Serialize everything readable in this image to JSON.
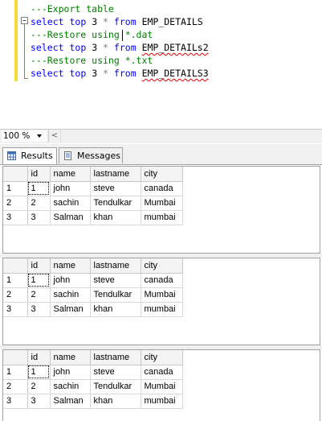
{
  "editor": {
    "lines": [
      {
        "parts": [
          {
            "t": "---Export table",
            "c": "cm"
          }
        ]
      },
      {
        "parts": [
          {
            "t": "select",
            "c": "kw"
          },
          {
            "t": " ",
            "c": ""
          },
          {
            "t": "top",
            "c": "kw"
          },
          {
            "t": " 3 ",
            "c": ""
          },
          {
            "t": "*",
            "c": "op"
          },
          {
            "t": " ",
            "c": ""
          },
          {
            "t": "from",
            "c": "kw"
          },
          {
            "t": " ",
            "c": ""
          },
          {
            "t": "EMP_DETAILS",
            "c": "obj-plain"
          }
        ]
      },
      {
        "parts": [
          {
            "t": "---Restore using *.dat",
            "c": "cm"
          }
        ]
      },
      {
        "parts": [
          {
            "t": "select",
            "c": "kw"
          },
          {
            "t": " ",
            "c": ""
          },
          {
            "t": "top",
            "c": "kw"
          },
          {
            "t": " 3 ",
            "c": ""
          },
          {
            "t": "*",
            "c": "op"
          },
          {
            "t": " ",
            "c": ""
          },
          {
            "t": "from",
            "c": "kw"
          },
          {
            "t": " ",
            "c": ""
          },
          {
            "t": "EMP_DETAILs2",
            "c": "obj"
          }
        ]
      },
      {
        "parts": [
          {
            "t": "---Restore using *.txt",
            "c": "cm"
          }
        ]
      },
      {
        "parts": [
          {
            "t": "select",
            "c": "kw"
          },
          {
            "t": " ",
            "c": ""
          },
          {
            "t": "top",
            "c": "kw"
          },
          {
            "t": " 3 ",
            "c": ""
          },
          {
            "t": "*",
            "c": "op"
          },
          {
            "t": " ",
            "c": ""
          },
          {
            "t": "from",
            "c": "kw"
          },
          {
            "t": " ",
            "c": ""
          },
          {
            "t": "EMP_DETAILS3",
            "c": "obj"
          }
        ]
      }
    ],
    "collapse_glyph": "−"
  },
  "zoom": {
    "value": "100 %",
    "scroll_left_glyph": "<"
  },
  "tabs": {
    "results_label": "Results",
    "messages_label": "Messages"
  },
  "colors": {
    "keyword": "#0000ff",
    "comment": "#008000",
    "change_bar": "#f4dc34",
    "error_underline": "#e00000"
  },
  "result_sets": [
    {
      "columns": [
        "id",
        "name",
        "lastname",
        "city"
      ],
      "rows": [
        {
          "num": "1",
          "cells": [
            "1",
            "john",
            "steve",
            "canada"
          ]
        },
        {
          "num": "2",
          "cells": [
            "2",
            "sachin",
            "Tendulkar",
            "Mumbai"
          ]
        },
        {
          "num": "3",
          "cells": [
            "3",
            "Salman",
            "khan",
            "mumbai"
          ]
        }
      ]
    },
    {
      "columns": [
        "id",
        "name",
        "lastname",
        "city"
      ],
      "rows": [
        {
          "num": "1",
          "cells": [
            "1",
            "john",
            "steve",
            "canada"
          ]
        },
        {
          "num": "2",
          "cells": [
            "2",
            "sachin",
            "Tendulkar",
            "Mumbai"
          ]
        },
        {
          "num": "3",
          "cells": [
            "3",
            "Salman",
            "khan",
            "mumbai"
          ]
        }
      ]
    },
    {
      "columns": [
        "id",
        "name",
        "lastname",
        "city"
      ],
      "rows": [
        {
          "num": "1",
          "cells": [
            "1",
            "john",
            "steve",
            "canada"
          ]
        },
        {
          "num": "2",
          "cells": [
            "2",
            "sachin",
            "Tendulkar",
            "Mumbai"
          ]
        },
        {
          "num": "3",
          "cells": [
            "3",
            "Salman",
            "khan",
            "mumbai"
          ]
        }
      ]
    }
  ]
}
